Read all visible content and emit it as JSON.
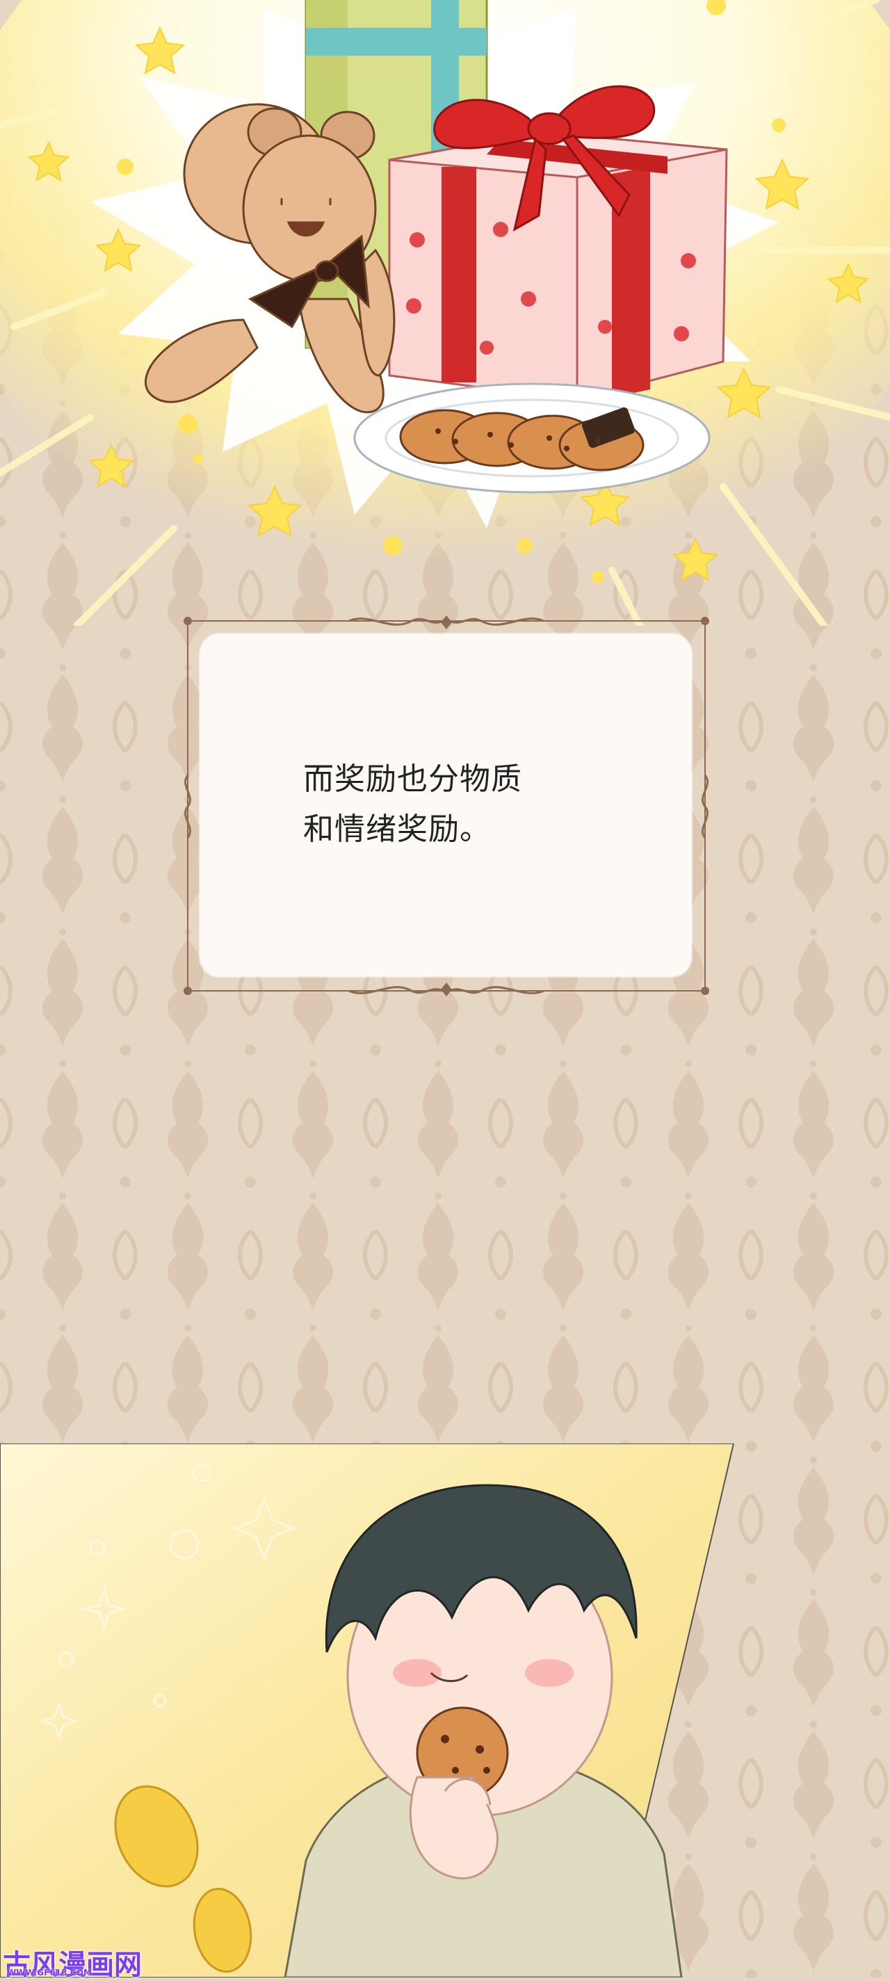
{
  "caption": {
    "line1": "而奖励也分物质",
    "line2": "和情绪奖励。"
  },
  "watermark": {
    "title": "古风漫画网",
    "url": "WWW.GF618.COM"
  },
  "colors": {
    "background": "#e6d6c4",
    "damask": "#dcc8b2",
    "glow": "#fff3a8",
    "star": "#ffe45a",
    "frame": "#8b6a50",
    "caption_box": "#fdfaf6",
    "watermark": "#7a3df0"
  },
  "icons": [
    "teddy-bear-icon",
    "gift-box-icon",
    "cookie-plate-icon",
    "star-icon",
    "cookie-icon",
    "coin-icon"
  ]
}
